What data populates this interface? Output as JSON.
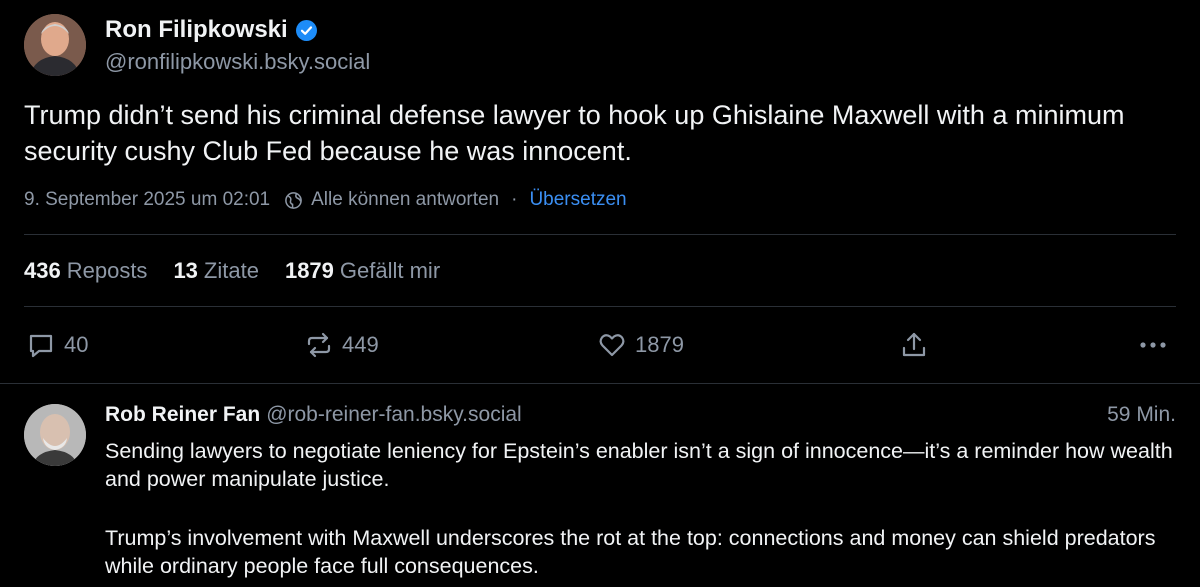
{
  "post": {
    "author_name": "Ron Filipkowski",
    "author_handle": "@ronfilipkowski.bsky.social",
    "text": "Trump didn’t send his criminal defense lawyer to hook up Ghislaine Maxwell with a minimum security cushy Club Fed because he was innocent.",
    "date": "9. September 2025 um 02:01",
    "reply_setting": "Alle können antworten",
    "separator": "·",
    "translate_label": "Übersetzen",
    "stats": {
      "reposts_count": "436",
      "reposts_label": "Reposts",
      "quotes_count": "13",
      "quotes_label": "Zitate",
      "likes_count": "1879",
      "likes_label": "Gefällt mir"
    },
    "actions": {
      "replies": "40",
      "reposts": "449",
      "likes": "1879"
    }
  },
  "reply": {
    "author_name": "Rob Reiner Fan",
    "author_handle": "@rob-reiner-fan.bsky.social",
    "time": "59 Min.",
    "paragraph1": "Sending lawyers to negotiate leniency for Epstein’s enabler isn’t a sign of innocence—it’s a reminder how wealth and power manipulate justice.",
    "paragraph2": "Trump’s involvement with Maxwell underscores the rot at the top: connections and money can shield predators while ordinary people face full consequences."
  },
  "colors": {
    "background": "#000000",
    "text_primary": "#f1f3f5",
    "text_secondary": "#8e98a6",
    "link": "#3b8ff3",
    "verified": "#1d8cf8",
    "divider": "#2a2f36"
  },
  "icons": [
    "verified-badge-icon",
    "globe-icon",
    "comment-icon",
    "repost-icon",
    "heart-icon",
    "share-icon",
    "more-icon"
  ]
}
